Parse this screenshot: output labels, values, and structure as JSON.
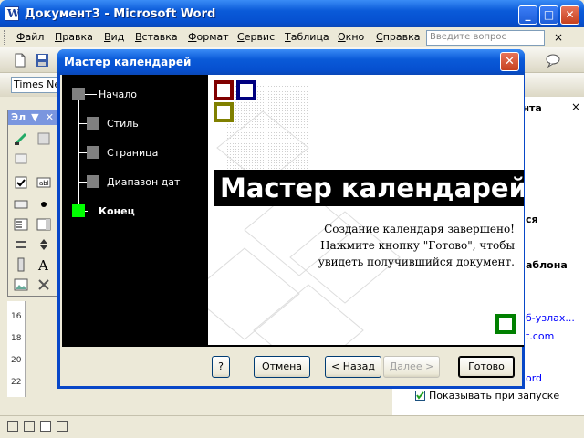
{
  "app": {
    "title": "Документ3 - Microsoft Word",
    "window_buttons": {
      "minimize": "_",
      "maximize": "□",
      "close": "✕"
    }
  },
  "menu": {
    "items": [
      "Файл",
      "Правка",
      "Вид",
      "Вставка",
      "Формат",
      "Сервис",
      "Таблица",
      "Окно",
      "Справка"
    ],
    "ask_placeholder": "Введите вопрос",
    "close": "×"
  },
  "formatting": {
    "font_name": "Times New Roman"
  },
  "toolbox": {
    "title": "Эл",
    "close": "✕"
  },
  "ruler": {
    "marks": [
      "16",
      "18",
      "20",
      "22"
    ]
  },
  "taskpane": {
    "header_fragment": "ента",
    "fragment_1": "ся",
    "fragment_2": "аблона",
    "link_1": "б-узлах...",
    "link_2": "t.com",
    "link_3": "ord",
    "show_on_startup": "Показывать при запуске"
  },
  "dialog": {
    "title": "Мастер календарей",
    "steps": [
      {
        "label": "Начало",
        "active": false
      },
      {
        "label": "Стиль",
        "active": false
      },
      {
        "label": "Страница",
        "active": false
      },
      {
        "label": "Диапазон дат",
        "active": false
      },
      {
        "label": "Конец",
        "active": true
      }
    ],
    "banner": "Мастер календарей",
    "message": "Создание календаря завершено! Нажмите кнопку \"Готово\", чтобы увидеть получившийся документ.",
    "buttons": {
      "help": "?",
      "cancel": "Отмена",
      "back": "< Назад",
      "next": "Далее >",
      "finish": "Готово"
    }
  },
  "colors": {
    "titlebar": "#0a5ad8",
    "active_step": "#00ff00",
    "square_red": "#800000",
    "square_blue": "#000080",
    "square_olive": "#808000",
    "square_green": "#008000"
  }
}
